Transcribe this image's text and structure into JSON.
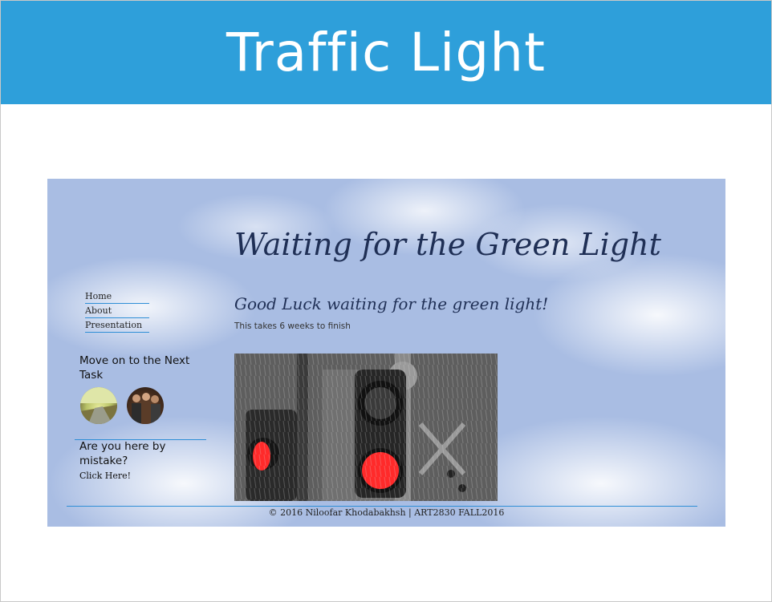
{
  "banner": {
    "title": "Traffic Light"
  },
  "site": {
    "title": "Waiting for the Green Light",
    "nav": [
      {
        "label": "Home"
      },
      {
        "label": "About"
      },
      {
        "label": "Presentation"
      }
    ],
    "next_task_heading": "Move on to the Next Task",
    "mistake_heading": "Are you here by mistake?",
    "mistake_link": "Click Here!",
    "content": {
      "heading": "Good Luck waiting for the green light!",
      "note": "This takes 6 weeks to finish"
    },
    "footer": "© 2016 Niloofar Khodabakhsh | ART2830 FALL2016"
  },
  "colors": {
    "banner": "#2e9fda",
    "sky": "#a9bde3",
    "title_text": "#1f2f55",
    "rule": "#2e8ed6",
    "signal_red": "#ff2a2a"
  }
}
